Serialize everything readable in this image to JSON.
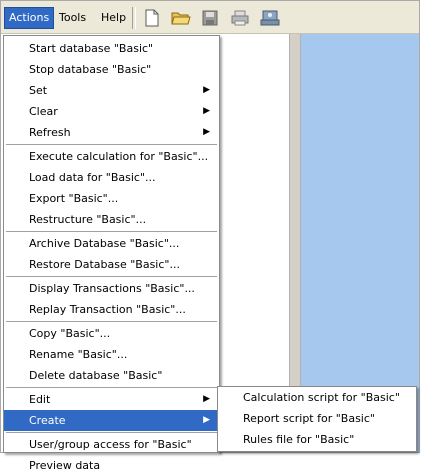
{
  "menubar": {
    "actions": "Actions",
    "tools": "Tools",
    "help": "Help"
  },
  "toolbar": [
    "new-document-icon",
    "open-folder-icon",
    "save-disk-icon",
    "print-icon",
    "network-drive-icon"
  ],
  "actions_menu": {
    "items": [
      "Start database \"Basic\"",
      "Stop database \"Basic\"",
      "Set",
      "Clear",
      "Refresh",
      "Execute calculation for \"Basic\"...",
      "Load data for \"Basic\"...",
      "Export \"Basic\"...",
      "Restructure \"Basic\"...",
      "Archive Database \"Basic\"...",
      "Restore Database \"Basic\"...",
      "Display Transactions \"Basic\"...",
      "Replay Transaction \"Basic\"...",
      "Copy \"Basic\"...",
      "Rename \"Basic\"...",
      "Delete database \"Basic\"",
      "Edit",
      "Create",
      "User/group access for \"Basic\"",
      "Preview data"
    ],
    "submenu_arrow": "▶",
    "selected": "Create"
  },
  "create_submenu": {
    "items": [
      "Calculation script for \"Basic\"",
      "Report script for \"Basic\"",
      "Rules file for \"Basic\""
    ]
  },
  "colors": {
    "selection": "#316ac5",
    "menubar_bg": "#ece9d8",
    "right_pane": "#a6c8ee"
  }
}
